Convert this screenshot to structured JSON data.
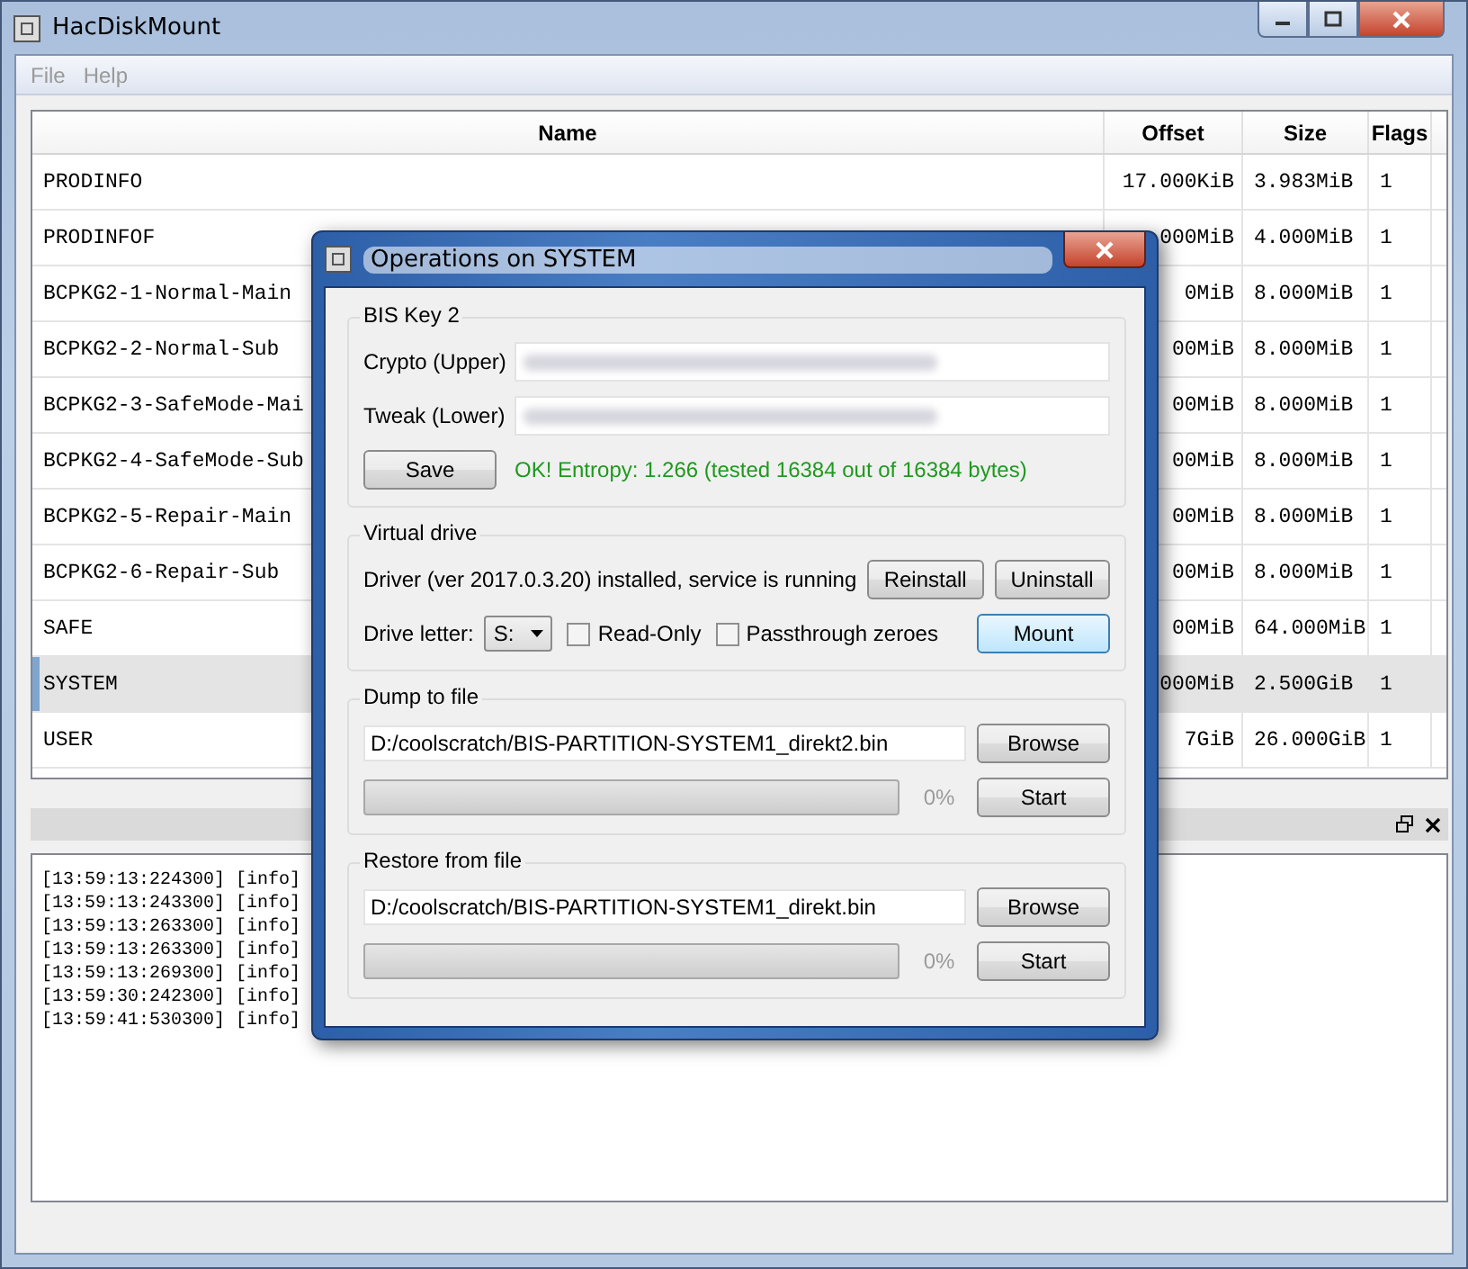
{
  "window": {
    "title": "HacDiskMount",
    "menu": [
      {
        "label": "File",
        "disabled": true
      },
      {
        "label": "Help",
        "disabled": true
      }
    ]
  },
  "table": {
    "columns": [
      "Name",
      "Offset",
      "Size",
      "Flags"
    ],
    "rows": [
      {
        "name": "PRODINFO",
        "offset": "17.000KiB",
        "size": "3.983MiB",
        "flags": "1",
        "selected": false
      },
      {
        "name": "PRODINFOF",
        "offset": "000MiB",
        "size": "4.000MiB",
        "flags": "1",
        "selected": false
      },
      {
        "name": "BCPKG2-1-Normal-Main",
        "offset": "0MiB",
        "size": "8.000MiB",
        "flags": "1",
        "selected": false
      },
      {
        "name": "BCPKG2-2-Normal-Sub",
        "offset": "00MiB",
        "size": "8.000MiB",
        "flags": "1",
        "selected": false
      },
      {
        "name": "BCPKG2-3-SafeMode-Mai",
        "offset": "00MiB",
        "size": "8.000MiB",
        "flags": "1",
        "selected": false
      },
      {
        "name": "BCPKG2-4-SafeMode-Sub",
        "offset": "00MiB",
        "size": "8.000MiB",
        "flags": "1",
        "selected": false
      },
      {
        "name": "BCPKG2-5-Repair-Main",
        "offset": "00MiB",
        "size": "8.000MiB",
        "flags": "1",
        "selected": false
      },
      {
        "name": "BCPKG2-6-Repair-Sub",
        "offset": "00MiB",
        "size": "8.000MiB",
        "flags": "1",
        "selected": false
      },
      {
        "name": "SAFE",
        "offset": "00MiB",
        "size": "64.000MiB",
        "flags": "1",
        "selected": false
      },
      {
        "name": "SYSTEM",
        "offset": "000MiB",
        "size": "2.500GiB",
        "flags": "1",
        "selected": true
      },
      {
        "name": "USER",
        "offset": "7GiB",
        "size": "26.000GiB",
        "flags": "1",
        "selected": false
      }
    ]
  },
  "log": {
    "lines": [
      "[13:59:13:224300] [info]",
      "[13:59:13:243300] [info]",
      "[13:59:13:263300] [info]",
      "[13:59:13:263300] [info]",
      "[13:59:13:269300] [info]",
      "[13:59:30:242300] [info]",
      "[13:59:41:530300] [info]"
    ]
  },
  "dialog": {
    "title": "Operations on SYSTEM",
    "bis_key": {
      "title": "BIS Key 2",
      "fields": [
        {
          "label": "Crypto (Upper)"
        },
        {
          "label": "Tweak (Lower)"
        }
      ],
      "save": "Save",
      "status": "OK! Entropy: 1.266 (tested 16384 out of 16384 bytes)"
    },
    "virtual_drive": {
      "title": "Virtual drive",
      "driver_status": "Driver (ver 2017.0.3.20) installed, service is running",
      "buttons": [
        {
          "label": "Reinstall",
          "focused": false
        },
        {
          "label": "Uninstall",
          "focused": false
        },
        {
          "label": "Mount",
          "focused": true
        }
      ],
      "drive_letter_label": "Drive letter:",
      "drive_letter": "S:",
      "options": [
        {
          "label": "Read-Only",
          "checked": false
        },
        {
          "label": "Passthrough zeroes",
          "checked": false
        }
      ]
    },
    "files": [
      {
        "title": "Dump to file",
        "path": "D:/coolscratch/BIS-PARTITION-SYSTEM1_direkt2.bin",
        "browse": "Browse",
        "level": 0,
        "percent": "0%",
        "start": "Start"
      },
      {
        "title": "Restore from file",
        "path": "D:/coolscratch/BIS-PARTITION-SYSTEM1_direkt.bin",
        "browse": "Browse",
        "level": 0,
        "percent": "0%",
        "start": "Start"
      }
    ]
  }
}
